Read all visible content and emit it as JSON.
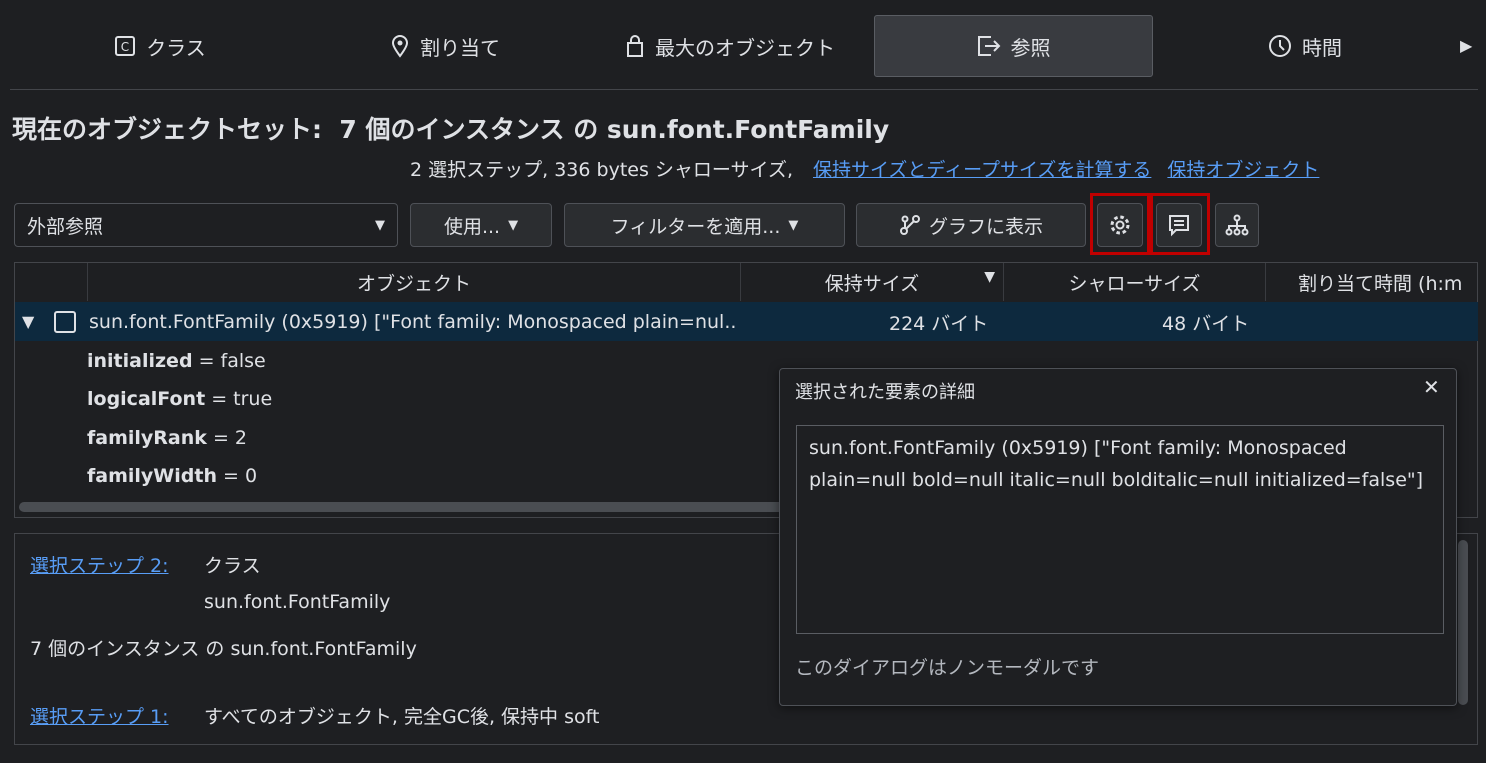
{
  "tabs": [
    {
      "label": "クラス",
      "icon": "class-icon"
    },
    {
      "label": "割り当て",
      "icon": "location-pin-icon"
    },
    {
      "label": "最大のオブジェクト",
      "icon": "bag-icon"
    },
    {
      "label": "参照",
      "icon": "export-icon",
      "active": true
    },
    {
      "label": "時間",
      "icon": "clock-icon"
    }
  ],
  "title": "現在のオブジェクトセット:  7 個のインスタンス の sun.font.FontFamily",
  "summary": "2 選択ステップ, 336 bytes シャローサイズ,",
  "links": {
    "calc": "保持サイズとディープサイズを計算する",
    "retained": "保持オブジェクト"
  },
  "toolbar": {
    "dropdown": "外部参照",
    "use": "使用...",
    "filter": "フィルターを適用...",
    "graph": "グラフに表示"
  },
  "table": {
    "headers": [
      "オブジェクト",
      "保持サイズ",
      "シャローサイズ",
      "割り当て時間 (h:m"
    ],
    "row": {
      "object": "sun.font.FontFamily (0x5919) [\"Font family: Monospaced plain=nul..",
      "retained": "224 バイト",
      "shallow": "48 バイト"
    },
    "props": [
      {
        "name": "initialized",
        "value": " = false"
      },
      {
        "name": "logicalFont",
        "value": " = true"
      },
      {
        "name": "familyRank",
        "value": " = 2"
      },
      {
        "name": "familyWidth",
        "value": " = 0"
      }
    ]
  },
  "steps": {
    "step2_link": "選択ステップ 2:",
    "step2_type": "クラス",
    "step2_class": "sun.font.FontFamily",
    "result": "7 個のインスタンス の sun.font.FontFamily",
    "step1_link": "選択ステップ 1:",
    "step1_text": "すべてのオブジェクト, 完全GC後, 保持中 soft"
  },
  "dialog": {
    "title": "選択された要素の詳細",
    "close": "✕",
    "content": "sun.font.FontFamily (0x5919) [\"Font family: Monospaced plain=null bold=null italic=null bolditalic=null initialized=false\"]",
    "footer": "このダイアログはノンモーダルです"
  },
  "colors": {
    "accent": "#589df6",
    "highlight": "#c00000",
    "selected_row": "#0d293e"
  }
}
